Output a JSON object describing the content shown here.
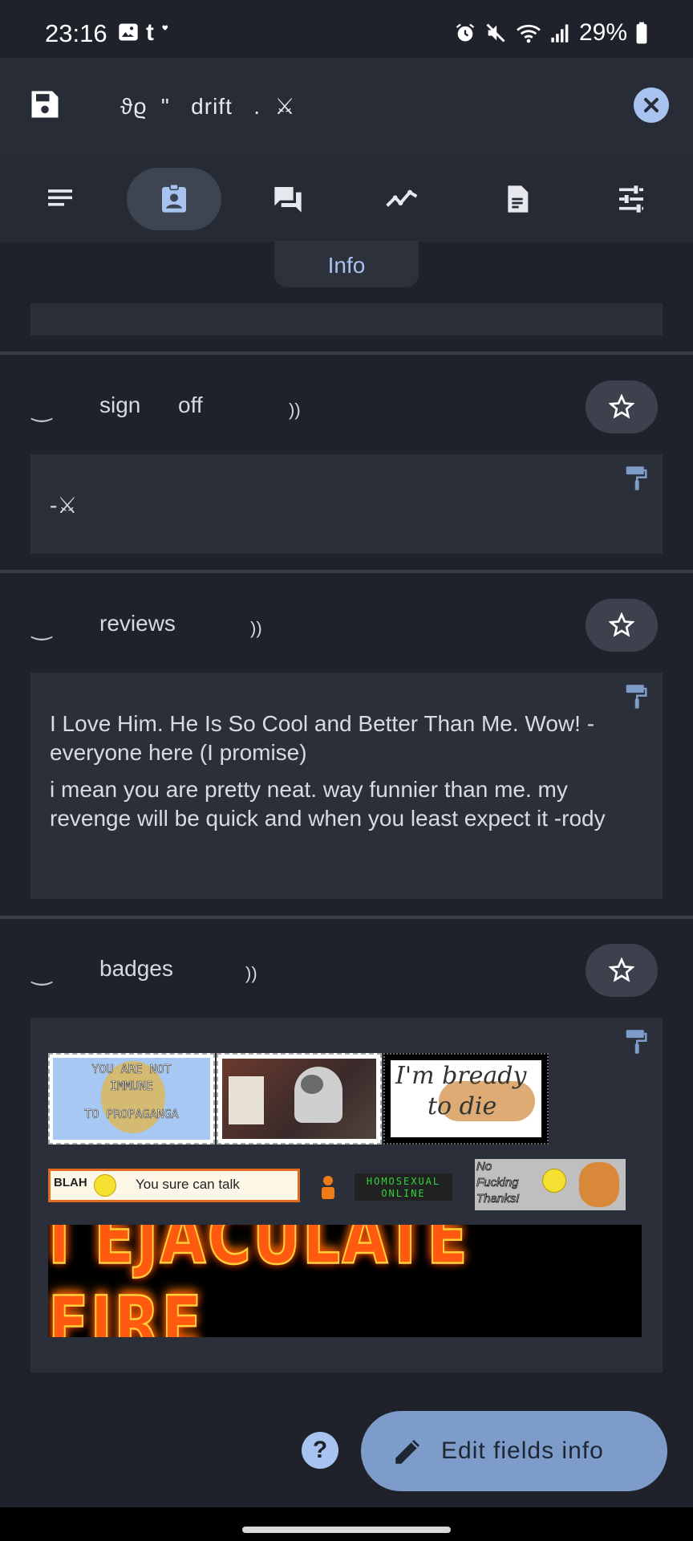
{
  "status_bar": {
    "time": "23:16",
    "battery": "29%",
    "icons": [
      "image-icon",
      "tumblr-icon",
      "alarm-icon",
      "mute-icon",
      "wifi-icon",
      "signal-icon",
      "battery-icon"
    ]
  },
  "app_bar": {
    "title": "ϑϱ  \"   drift   .  ⚔",
    "save_icon": "save-icon",
    "close_icon": "close-icon",
    "accent": "#a9c3f0"
  },
  "tabs": {
    "items": [
      "list-icon",
      "profile-icon",
      "chat-icon",
      "timeline-icon",
      "document-icon",
      "tune-icon"
    ],
    "active_index": 1,
    "tooltip": "Info"
  },
  "sections": [
    {
      "smile": "‿",
      "label": "sign      off",
      "deco": "))",
      "content": [
        "-⚔"
      ]
    },
    {
      "smile": "‿",
      "label": "reviews",
      "deco": "))",
      "content": [
        "I Love Him. He Is So Cool and Better Than Me. Wow! -everyone here (I promise)",
        "i mean you are pretty neat. way funnier than me. my revenge will be quick and when you least expect it -rody"
      ]
    },
    {
      "smile": "‿",
      "label": "badges",
      "deco": "))",
      "badges": {
        "propaganda": [
          "YOU ARE NOT",
          "IMMUNE",
          "TO PROPAGANGA"
        ],
        "bread": [
          "I'm bready",
          "to die"
        ],
        "blah": "BLAH",
        "talk": "You sure can talk",
        "homosexual": [
          "HOMOSEXUAL",
          "ONLINE"
        ],
        "nft": [
          "No",
          "Fucking",
          "Thanks!"
        ],
        "fire": "I EJACULATE FIRE"
      }
    }
  ],
  "footer": {
    "help": "?",
    "edit_label": "Edit fields info"
  },
  "colors": {
    "background": "#1f222b",
    "card": "#2b2f39",
    "fab": "#7d9cc9",
    "fire": "#ff5a10"
  }
}
